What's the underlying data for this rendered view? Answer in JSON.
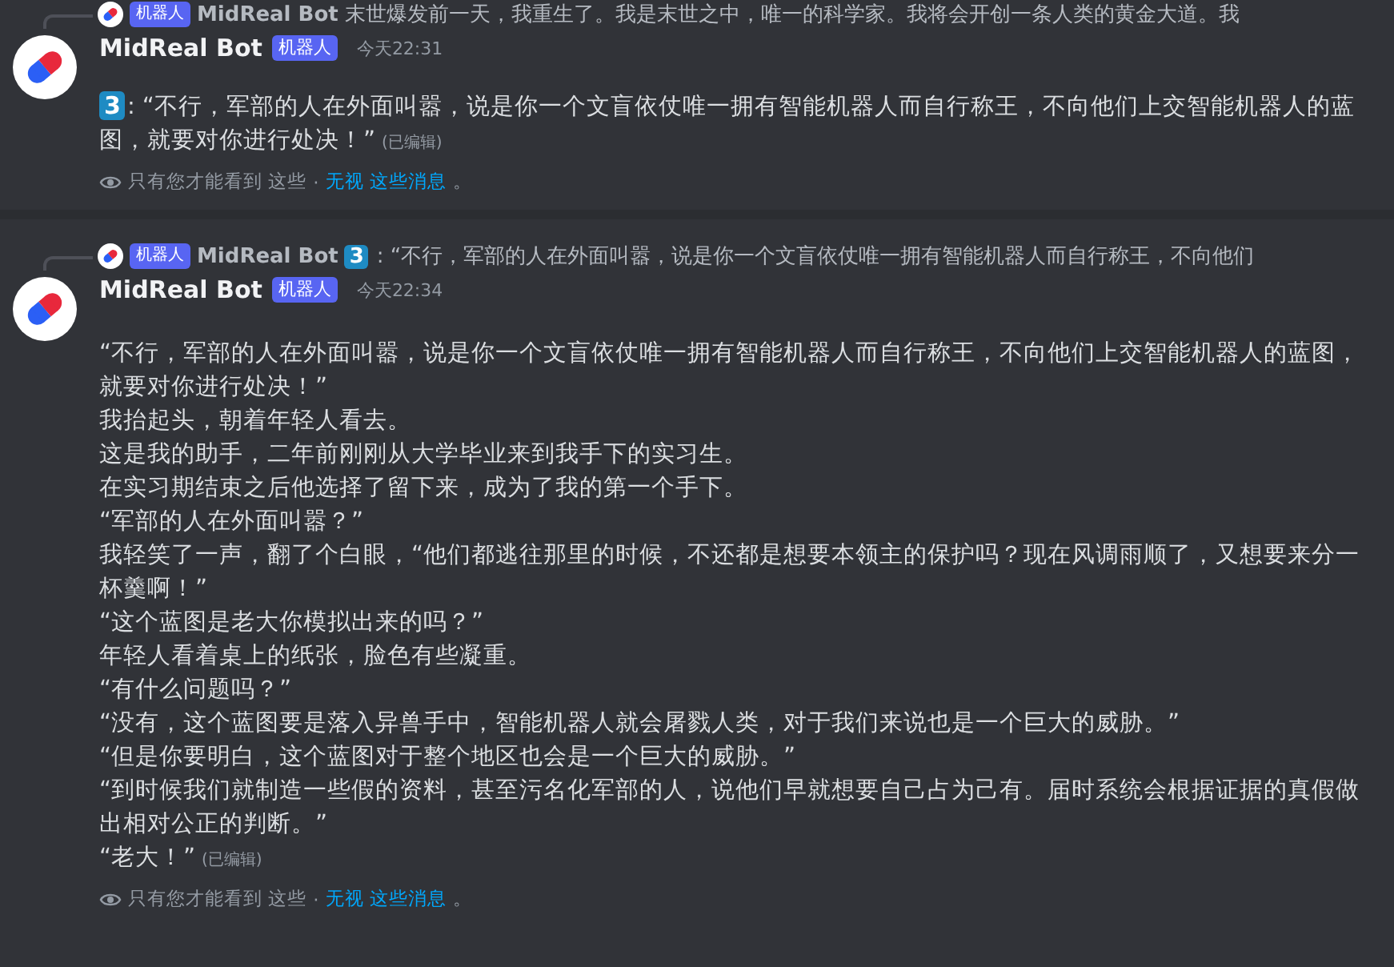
{
  "messages": [
    {
      "reply": {
        "tag": "机器人",
        "author": "MidReal Bot",
        "text": "末世爆发前一天，我重生了。我是末世之中，唯一的科学家。我将会开创一条人类的黄金大道。我"
      },
      "author": "MidReal Bot",
      "tag": "机器人",
      "time": "今天22:31",
      "badge": "3",
      "paragraphs": [
        ": “不行，军部的人在外面叫嚣，说是你一个文盲依仗唯一拥有智能机器人而自行称王，不向他们上交智能机器人的蓝图，就要对你进行处决！”"
      ],
      "edited": "(已编辑)",
      "notice": {
        "text": "只有您才能看到 这些",
        "separator": "·",
        "link": "无视 这些消息",
        "end": "。"
      }
    },
    {
      "reply": {
        "tag": "机器人",
        "author": "MidReal Bot",
        "badge": "3",
        "text": ": “不行，军部的人在外面叫嚣，说是你一个文盲依仗唯一拥有智能机器人而自行称王，不向他们"
      },
      "author": "MidReal Bot",
      "tag": "机器人",
      "time": "今天22:34",
      "paragraphs": [
        "“不行，军部的人在外面叫嚣，说是你一个文盲依仗唯一拥有智能机器人而自行称王，不向他们上交智能机器人的蓝图，就要对你进行处决！”",
        "我抬起头，朝着年轻人看去。",
        "这是我的助手，二年前刚刚从大学毕业来到我手下的实习生。",
        "在实习期结束之后他选择了留下来，成为了我的第一个手下。",
        "“军部的人在外面叫嚣？”",
        "我轻笑了一声，翻了个白眼，“他们都逃往那里的时候，不还都是想要本领主的保护吗？现在风调雨顺了，又想要来分一杯羹啊！”",
        "“这个蓝图是老大你模拟出来的吗？”",
        "年轻人看着桌上的纸张，脸色有些凝重。",
        "“有什么问题吗？”",
        "“没有，这个蓝图要是落入异兽手中，智能机器人就会屠戮人类，对于我们来说也是一个巨大的威胁。”",
        "“但是你要明白，这个蓝图对于整个地区也会是一个巨大的威胁。”",
        "“到时候我们就制造一些假的资料，甚至污名化军部的人，说他们早就想要自己占为己有。届时系统会根据证据的真假做出相对公正的判断。”",
        "“老大！”"
      ],
      "edited": "(已编辑)",
      "notice": {
        "text": "只有您才能看到 这些",
        "separator": "·",
        "link": "无视 这些消息",
        "end": "。"
      }
    }
  ]
}
